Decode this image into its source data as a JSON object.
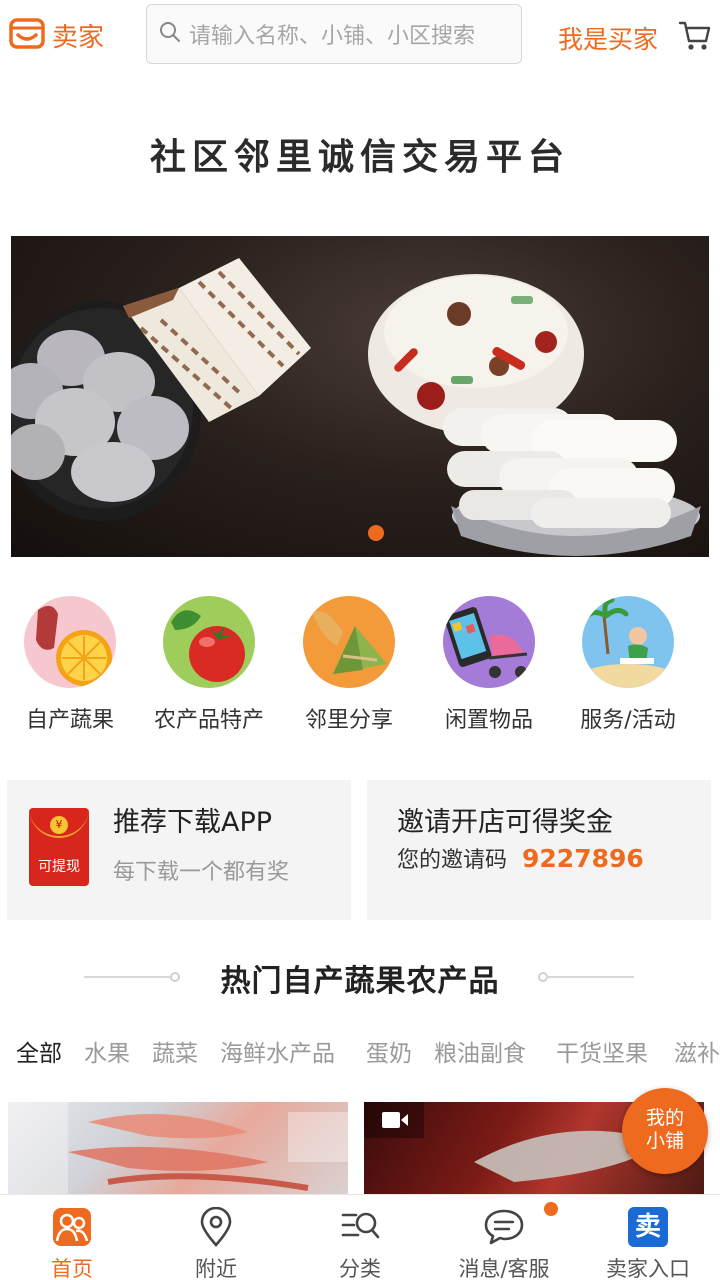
{
  "header": {
    "seller_label": "卖家",
    "search_placeholder": "请输入名称、小铺、小区搜索",
    "buyer_label": "我是买家"
  },
  "slogan": "社区邻里诚信交易平台",
  "banner": {
    "slides": 1,
    "active_slide": 1
  },
  "categories": [
    {
      "label": "自产蔬果",
      "icon": "meat-orange-icon"
    },
    {
      "label": "农产品特产",
      "icon": "tomato-icon"
    },
    {
      "label": "邻里分享",
      "icon": "bread-zongzi-icon"
    },
    {
      "label": "闲置物品",
      "icon": "phone-stroller-icon"
    },
    {
      "label": "服务/活动",
      "icon": "beach-reading-icon"
    }
  ],
  "promo": {
    "download": {
      "title": "推荐下载APP",
      "subtitle": "每下载一个都有奖",
      "redpacket_text": "可提现",
      "coin_symbol": "¥"
    },
    "invite": {
      "title": "邀请开店可得奖金",
      "code_label": "您的邀请码",
      "code": "9227896"
    }
  },
  "section": {
    "title": "热门自产蔬果农产品"
  },
  "tabs": [
    "全部",
    "水果",
    "蔬菜",
    "海鲜水产品",
    "蛋奶",
    "粮油副食",
    "干货坚果",
    "滋补"
  ],
  "active_tab": "全部",
  "floating": {
    "my_shop_line1": "我的",
    "my_shop_line2": "小铺"
  },
  "nav": [
    {
      "label": "首页",
      "icon": "home-people-icon",
      "active": true
    },
    {
      "label": "附近",
      "icon": "location-pin-icon",
      "active": false
    },
    {
      "label": "分类",
      "icon": "category-search-icon",
      "active": false
    },
    {
      "label": "消息/客服",
      "icon": "chat-bubble-icon",
      "active": false
    },
    {
      "label": "卖家入口",
      "icon": "sell-badge-icon",
      "active": false,
      "badge_text": "卖"
    }
  ],
  "colors": {
    "accent": "#ee6a1f",
    "text": "#222222",
    "muted": "#9a9a9a"
  }
}
